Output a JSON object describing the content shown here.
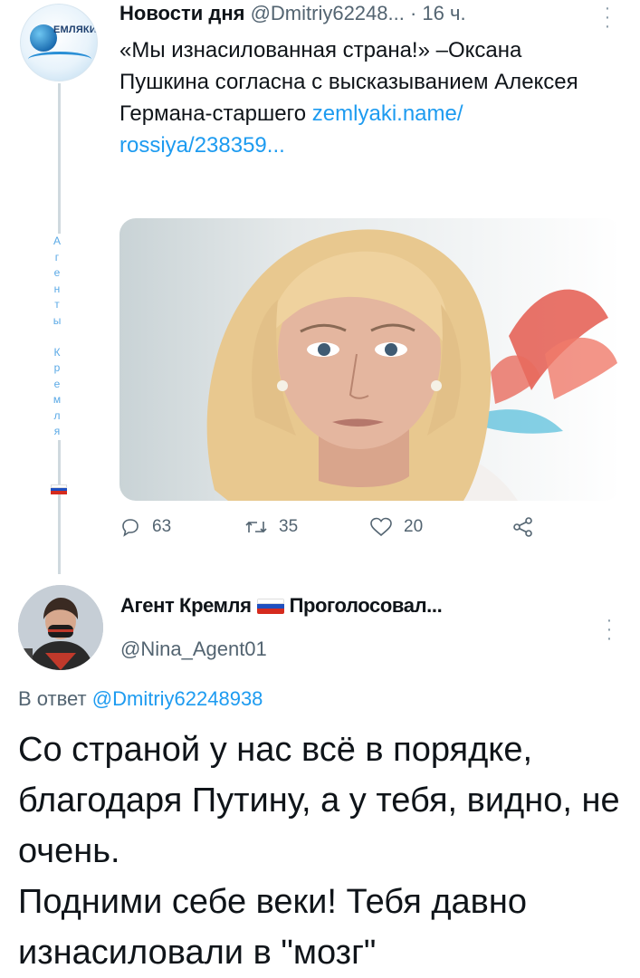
{
  "tweet": {
    "author_name": "Новости дня",
    "author_handle": "@Dmitriy62248...",
    "time": "· 16 ч.",
    "avatar_brand": "ЕМЛЯКИ",
    "text": "«Мы изнасилованная страна!» –Оксана Пушкина согласна с высказыванием Алексея Германа-старшего ",
    "link": "zemlyaki.name/ rossiya/238359...",
    "side_label": [
      "А",
      "г",
      "е",
      "н",
      "т",
      "ы",
      "",
      "К",
      "р",
      "е",
      "м",
      "л",
      "я"
    ],
    "stats": {
      "replies": "63",
      "retweets": "35",
      "likes": "20"
    },
    "icons": [
      "reply-icon",
      "retweet-icon",
      "like-icon",
      "share-icon",
      "more-icon"
    ]
  },
  "reply": {
    "author_name": "Агент Кремля",
    "author_name_suffix": "Проголосовал...",
    "author_handle": "@Nina_Agent01",
    "reply_to_prefix": "В ответ",
    "reply_to_handle": "@Dmitriy62248938",
    "text_line1": "Со страной у нас всё в порядке, благодаря Путину, а у тебя, видно, не очень.",
    "text_line2": "Подними себе веки! Тебя давно изнасиловали в \"мозг\""
  },
  "colors": {
    "link": "#1d9bf0",
    "secondary": "#536471",
    "thread_line": "#cfd9de",
    "flag": [
      "#ffffff",
      "#1f4fbf",
      "#d52b1e"
    ]
  }
}
